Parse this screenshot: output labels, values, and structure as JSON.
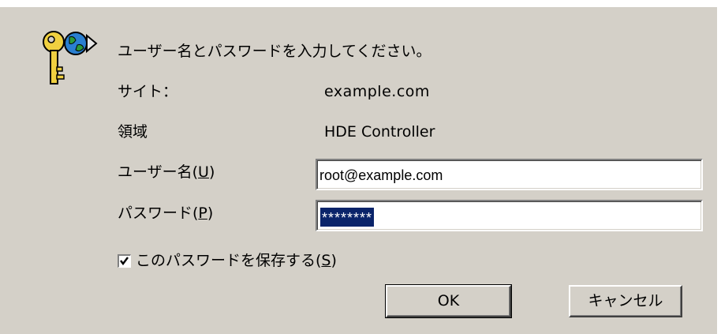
{
  "dialog": {
    "prompt": "ユーザー名とパスワードを入力してください。",
    "site_label": "サイト：",
    "site_value": "example.com",
    "realm_label": "領域",
    "realm_value": "HDE Controller",
    "username_label": "ユーザー名(",
    "username_mnemonic": "U",
    "username_value": "root@example.com",
    "password_label": "パスワード(",
    "password_mnemonic": "P",
    "password_value": "********",
    "save_password_label": "このパスワードを保存する(",
    "save_password_mnemonic": "S",
    "save_password_checked": true,
    "label_close": ")",
    "ok_label": "OK",
    "cancel_label": "キャンセル"
  },
  "icons": {
    "dialog_icon": "key-globe-icon",
    "checkbox_mark": "checkmark-icon"
  },
  "colors": {
    "dialog_bg": "#d4d0c8",
    "selection_bg": "#0a246a",
    "key_gold": "#e0c020"
  }
}
